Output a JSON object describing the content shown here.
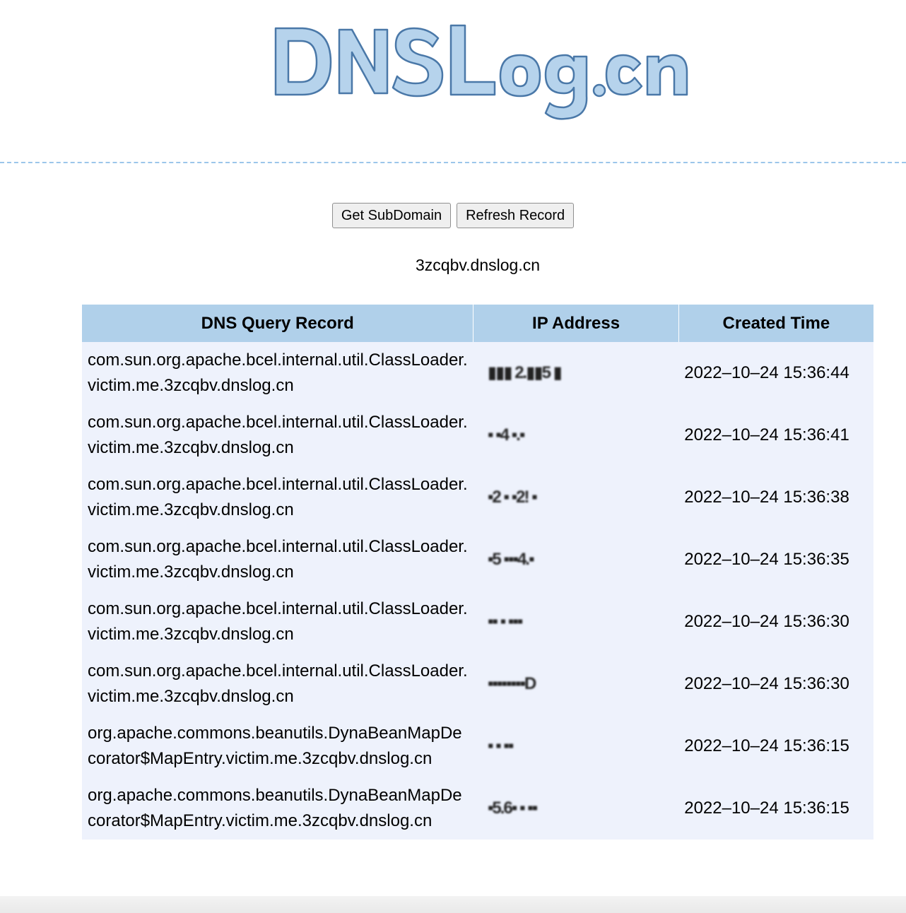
{
  "logo": {
    "text": "DNSLog.cn",
    "color": "#b6d3ec",
    "outline": "#4a78a8"
  },
  "toolbar": {
    "get_subdomain_label": "Get SubDomain",
    "refresh_record_label": "Refresh Record"
  },
  "subdomain": "3zcqbv.dnslog.cn",
  "table": {
    "headers": [
      "DNS Query Record",
      "IP Address",
      "Created Time"
    ],
    "rows": [
      {
        "query": "com.sun.org.apache.bcel.internal.util.ClassLoader.victim.me.3zcqbv.dnslog.cn",
        "ip": "▮▮▮ 2.▮▮5 ▮",
        "time": "2022–10–24 15:36:44"
      },
      {
        "query": "com.sun.org.apache.bcel.internal.util.ClassLoader.victim.me.3zcqbv.dnslog.cn",
        "ip": "▪ ▪4 ▪.▪",
        "time": "2022–10–24 15:36:41"
      },
      {
        "query": "com.sun.org.apache.bcel.internal.util.ClassLoader.victim.me.3zcqbv.dnslog.cn",
        "ip": "▪2 ▪ ▪2! ▪",
        "time": "2022–10–24 15:36:38"
      },
      {
        "query": "com.sun.org.apache.bcel.internal.util.ClassLoader.victim.me.3zcqbv.dnslog.cn",
        "ip": "▪5 ▪▪▪4.▪",
        "time": "2022–10–24 15:36:35"
      },
      {
        "query": "com.sun.org.apache.bcel.internal.util.ClassLoader.victim.me.3zcqbv.dnslog.cn",
        "ip": "▪▪  ▪ ▪▪▪",
        "time": "2022–10–24 15:36:30"
      },
      {
        "query": "com.sun.org.apache.bcel.internal.util.ClassLoader.victim.me.3zcqbv.dnslog.cn",
        "ip": "▪▪▪▪▪▪▪▪D",
        "time": "2022–10–24 15:36:30"
      },
      {
        "query": "org.apache.commons.beanutils.DynaBeanMapDecorator$MapEntry.victim.me.3zcqbv.dnslog.cn",
        "ip": "▪ ▪ ▪▪",
        "time": "2022–10–24 15:36:15"
      },
      {
        "query": "org.apache.commons.beanutils.DynaBeanMapDecorator$MapEntry.victim.me.3zcqbv.dnslog.cn",
        "ip": "▪5.6▪ ▪ ▪▪",
        "time": "2022–10–24 15:36:15"
      }
    ]
  }
}
